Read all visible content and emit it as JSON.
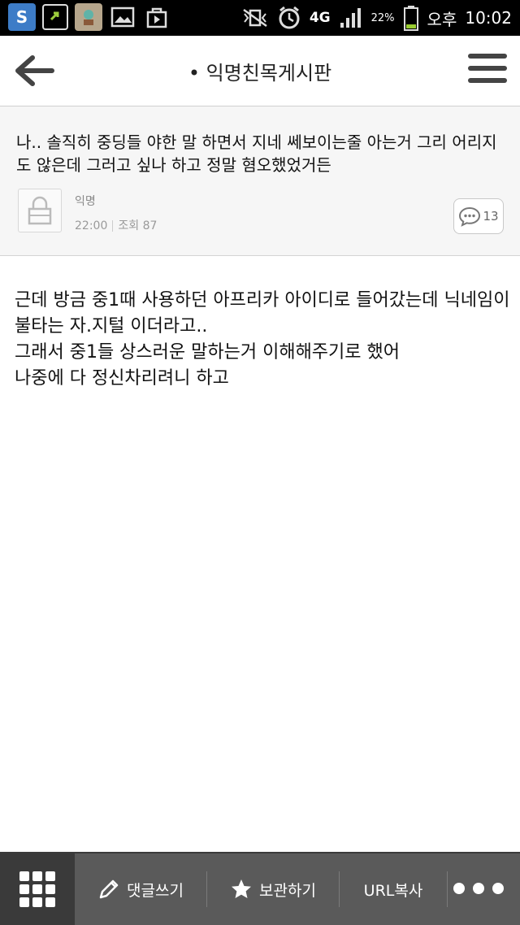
{
  "status_bar": {
    "battery": "22%",
    "network": "4G",
    "ampm": "오후",
    "time": "10:02"
  },
  "app_bar": {
    "title": "• 익명친목게시판"
  },
  "post": {
    "title": "나.. 솔직히 중딩들 야한 말 하면서 지네 쎄보이는줄 아는거 그리 어리지도 않은데 그러고 싶나 하고 정말 혐오했었거든",
    "author": "익명",
    "time": "22:00",
    "views": "조회 87",
    "comment_count": "13",
    "body_lines": [
      "근데 방금 중1때 사용하던 아프리카 아이디로 들어갔는데 닉네임이 불타는 자.지털 이더라고..",
      "그래서 중1들 상스러운 말하는거 이해해주기로 했어",
      "나중에 다 정신차리려니 하고"
    ]
  },
  "bottom_bar": {
    "comment_label": "댓글쓰기",
    "save_label": "보관하기",
    "url_copy_label": "URL복사"
  },
  "colors": {
    "status_bar_bg": "#000000",
    "bottom_bar_bg": "#5a5a5a",
    "header_card_bg": "#f6f6f6"
  }
}
